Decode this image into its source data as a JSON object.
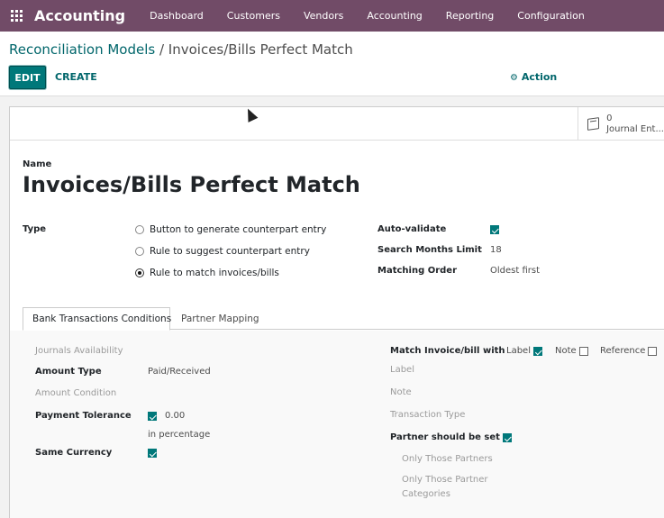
{
  "navbar": {
    "brand": "Accounting",
    "menu": [
      "Dashboard",
      "Customers",
      "Vendors",
      "Accounting",
      "Reporting",
      "Configuration"
    ]
  },
  "breadcrumb": {
    "parent": "Reconciliation Models",
    "separator": " / ",
    "current": "Invoices/Bills Perfect Match"
  },
  "toolbar": {
    "edit_label": "EDIT",
    "create_label": "CREATE",
    "action_label": "Action"
  },
  "smart_button": {
    "value": "0",
    "label": "Journal Ent..."
  },
  "form": {
    "name_label": "Name",
    "name_value": "Invoices/Bills Perfect Match",
    "type_label": "Type",
    "type_options": [
      {
        "label": "Button to generate counterpart entry",
        "selected": false
      },
      {
        "label": "Rule to suggest counterpart entry",
        "selected": false
      },
      {
        "label": "Rule to match invoices/bills",
        "selected": true
      }
    ],
    "auto_validate_label": "Auto-validate",
    "auto_validate": true,
    "search_months_label": "Search Months Limit",
    "search_months_value": "18",
    "matching_order_label": "Matching Order",
    "matching_order_value": "Oldest first"
  },
  "tabs": [
    "Bank Transactions Conditions",
    "Partner Mapping"
  ],
  "conditions": {
    "journals_label": "Journals Availability",
    "amount_type_label": "Amount Type",
    "amount_type_value": "Paid/Received",
    "amount_condition_label": "Amount Condition",
    "payment_tolerance_label": "Payment Tolerance",
    "payment_tolerance_value": "0.00",
    "payment_tolerance_checked": true,
    "payment_tolerance_unit": "in percentage",
    "same_currency_label": "Same Currency",
    "same_currency": true,
    "match_label": "Match Invoice/bill with",
    "match_options": [
      {
        "label": "Label",
        "checked": true
      },
      {
        "label": "Note",
        "checked": false
      },
      {
        "label": "Reference",
        "checked": false
      }
    ],
    "label_label": "Label",
    "note_label": "Note",
    "transaction_type_label": "Transaction Type",
    "partner_set_label": "Partner should be set",
    "partner_set": true,
    "only_partners_label": "Only Those Partners",
    "only_categories_label_1": "Only Those Partner",
    "only_categories_label_2": "Categories"
  },
  "colors": {
    "navbar": "#714b67",
    "primary": "#00787a",
    "link": "#01666b"
  }
}
